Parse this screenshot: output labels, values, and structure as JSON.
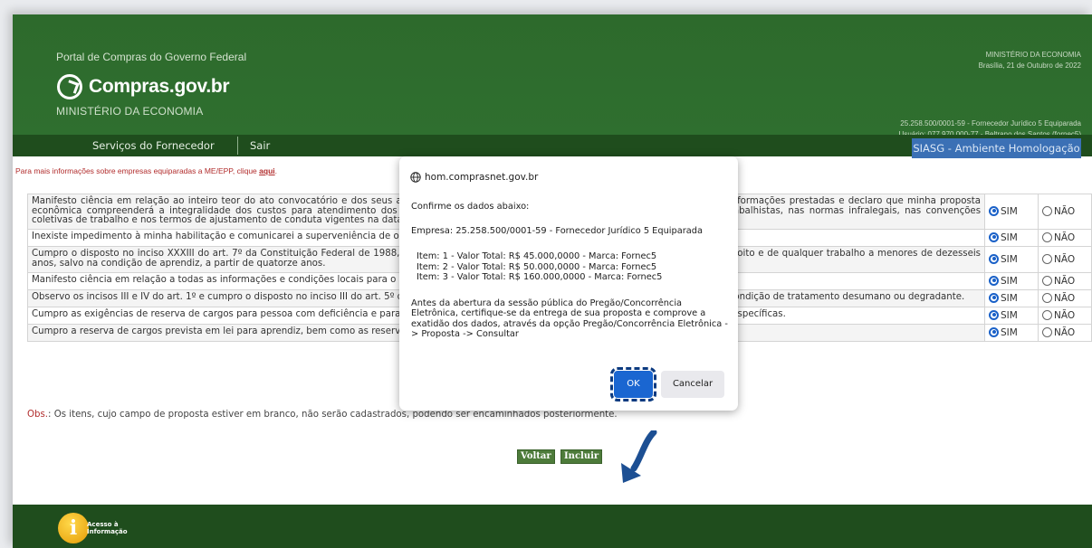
{
  "header": {
    "portal_title": "Portal de Compras do Governo Federal",
    "logo_text": "Compras.gov.br",
    "ministry": "MINISTÉRIO DA ECONOMIA",
    "top_right_line1": "MINISTÉRIO DA ECONOMIA",
    "top_right_line2": "Brasília, 21 de Outubro de 2022",
    "supplier_line": "25.258.500/0001-59 - Fornecedor Jurídico 5 Equiparada",
    "user_line": "Usuário: 077.970.000-77 - Beltrano dos Santos (fornec5)"
  },
  "nav": {
    "services": "Serviços do Fornecedor",
    "exit": "Sair",
    "environment": "SIASG - Ambiente Homologação"
  },
  "info": {
    "text": "Para mais informações sobre empresas equiparadas a ME/EPP, clique ",
    "link": "aqui",
    "end": "."
  },
  "declarations": [
    {
      "text": "Manifesto ciência em relação ao inteiro teor do ato convocatório e dos seus anexos, concordo com suas condições, respondo pela veracidade das informações prestadas e declaro que minha proposta econômica compreenderá a integralidade dos custos para atendimento dos direitos trabalhistas assegurados na Constituição Federal, nas leis trabalhistas, nas normas infralegais, nas convenções coletivas de trabalho e nos termos de ajustamento de conduta vigentes na data da sua entrega em definitivo e atendo aos requisitos de habilitação."
    },
    {
      "text": "Inexiste impedimento à minha habilitação e comunicarei a superveniência de ocorrência impeditiva ao órgão ou entidade contratante."
    },
    {
      "text": "Cumpro o disposto no inciso XXXIII do art. 7º da Constituição Federal de 1988, que proíbe o trabalho noturno, perigoso ou insalubre a menores de dezoito e de qualquer trabalho a menores de dezesseis anos, salvo na condição de aprendiz, a partir de quatorze anos."
    },
    {
      "text": "Manifesto ciência em relação a todas as informações e condições locais para o cumprimento das obrigações objeto da licitação."
    },
    {
      "text": "Observo os incisos III e IV do art. 1º e cumpro o disposto no inciso III do art. 5º da Constituição Federal, não utilizando trabalho infantil, forçado ou em condição de tratamento desumano ou degradante."
    },
    {
      "text": "Cumpro as exigências de reserva de cargos para pessoa com deficiência e para reabilitado da Previdência Social, previstas em lei e em outras normas específicas."
    },
    {
      "text": "Cumpro a reserva de cargos prevista em lei para aprendiz, bem como as reservas de cargos previstas em outras normas específicas, quando cabíveis."
    }
  ],
  "options": {
    "yes": "SIM",
    "no": "NÃO"
  },
  "obs": {
    "label": "Obs.",
    "text": ": Os itens, cujo campo de proposta estiver em branco, não serão cadastrados, podendo ser encaminhados posteriormente."
  },
  "buttons": {
    "back": "Voltar",
    "include": "Incluir"
  },
  "footer": {
    "access_line1": "Acesso à",
    "access_line2": "Informação",
    "icon_letter": "i"
  },
  "dialog": {
    "host": "hom.comprasnet.gov.br",
    "confirm": "Confirme os dados abaixo:",
    "company": "Empresa: 25.258.500/0001-59 - Fornecedor Jurídico 5 Equiparada",
    "items": [
      "Item: 1 - Valor Total: R$ 45.000,0000 - Marca: Fornec5",
      "Item: 2 - Valor Total: R$ 50.000,0000 - Marca: Fornec5",
      "Item: 3 - Valor Total: R$ 160.000,0000 - Marca: Fornec5"
    ],
    "notice": "Antes da abertura da sessão pública do Pregão/Concorrência Eletrônica, certifique-se da entrega de sua proposta e comprove a exatidão dos dados, através da opção Pregão/Concorrência Eletrônica -> Proposta -> Consultar",
    "ok": "OK",
    "cancel": "Cancelar"
  },
  "colors": {
    "header_green": "#2f6d2e",
    "nav_green": "#1f4d1d",
    "environment_blue": "#3b70b5",
    "ok_blue": "#1a66d1"
  }
}
